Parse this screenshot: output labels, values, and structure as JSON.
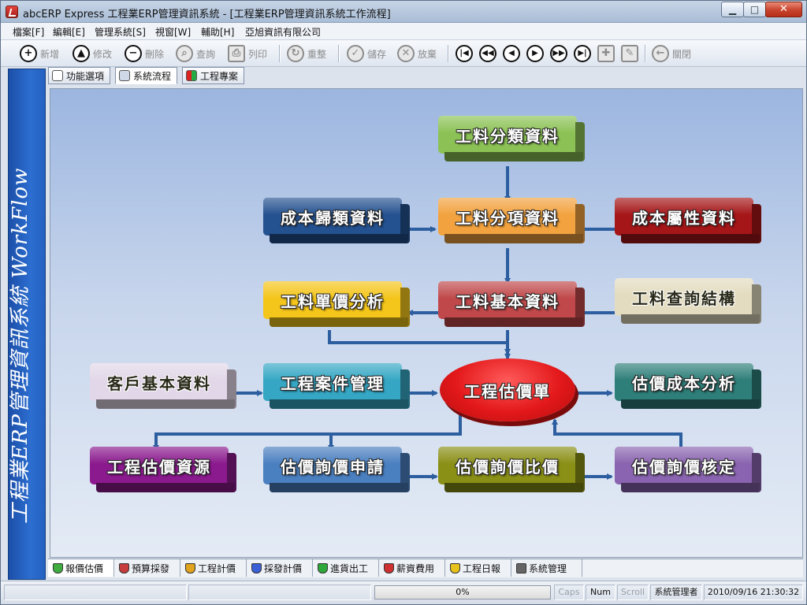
{
  "window": {
    "title": "abcERP Express 工程業ERP管理資訊系統 - [工程業ERP管理資訊系統工作流程]"
  },
  "menu": [
    "檔案[F]",
    "編輯[E]",
    "管理系統[S]",
    "視窗[W]",
    "輔助[H]",
    "亞旭資訊有限公司"
  ],
  "toolbar": {
    "new": "新增",
    "edit": "修改",
    "delete": "刪除",
    "query": "查詢",
    "print": "列印",
    "reset": "重整",
    "save": "儲存",
    "discard": "放棄",
    "close": "關閉"
  },
  "sidebar": {
    "text": "工程業ERP管理資訊系統  WorkFlow"
  },
  "top_tabs": [
    {
      "label": "功能選項"
    },
    {
      "label": "系統流程"
    },
    {
      "label": "工程專案"
    }
  ],
  "workflow": {
    "material_category": "工料分類資料",
    "cost_category": "成本歸類資料",
    "material_item": "工料分項資料",
    "cost_attribute": "成本屬性資料",
    "unit_price_analysis": "工料單價分析",
    "material_basic": "工料基本資料",
    "material_query": "工料查詢結構",
    "customer_basic": "客戶基本資料",
    "case_management": "工程案件管理",
    "estimate_sheet": "工程估價單",
    "estimate_cost_analysis": "估價成本分析",
    "estimate_resources": "工程估價資源",
    "inquiry_request": "估價詢價申請",
    "inquiry_compare": "估價詢價比價",
    "inquiry_approve": "估價詢價核定"
  },
  "bottom_tabs": [
    {
      "label": "報價估價",
      "color": "#3fae3f"
    },
    {
      "label": "預算採發",
      "color": "#c73c3c"
    },
    {
      "label": "工程計價",
      "color": "#e2a31d"
    },
    {
      "label": "採發計價",
      "color": "#3b5fd6"
    },
    {
      "label": "進貨出工",
      "color": "#2ea83a"
    },
    {
      "label": "薪資費用",
      "color": "#cf3030"
    },
    {
      "label": "工程日報",
      "color": "#e6c21b"
    },
    {
      "label": "系統管理",
      "color": "#666666"
    }
  ],
  "status": {
    "progress": "0%",
    "caps": "Caps",
    "num": "Num",
    "scroll": "Scroll",
    "user": "系統管理者",
    "datetime": "2010/09/16 21:30:32"
  },
  "colors": {
    "green": "#8cc255",
    "orange": "#f2a23f",
    "navy": "#24518f",
    "maroon": "#a51618",
    "yellow": "#f4c51a",
    "brick": "#c0484a",
    "beige": "#e3dcc0",
    "lavender": "#e2d7e8",
    "cyan": "#35a7c4",
    "teal": "#2e7e79",
    "purple": "#8b1a8e",
    "steel": "#4a7fc0",
    "olive": "#8a8f16",
    "violet": "#8a64b0"
  }
}
